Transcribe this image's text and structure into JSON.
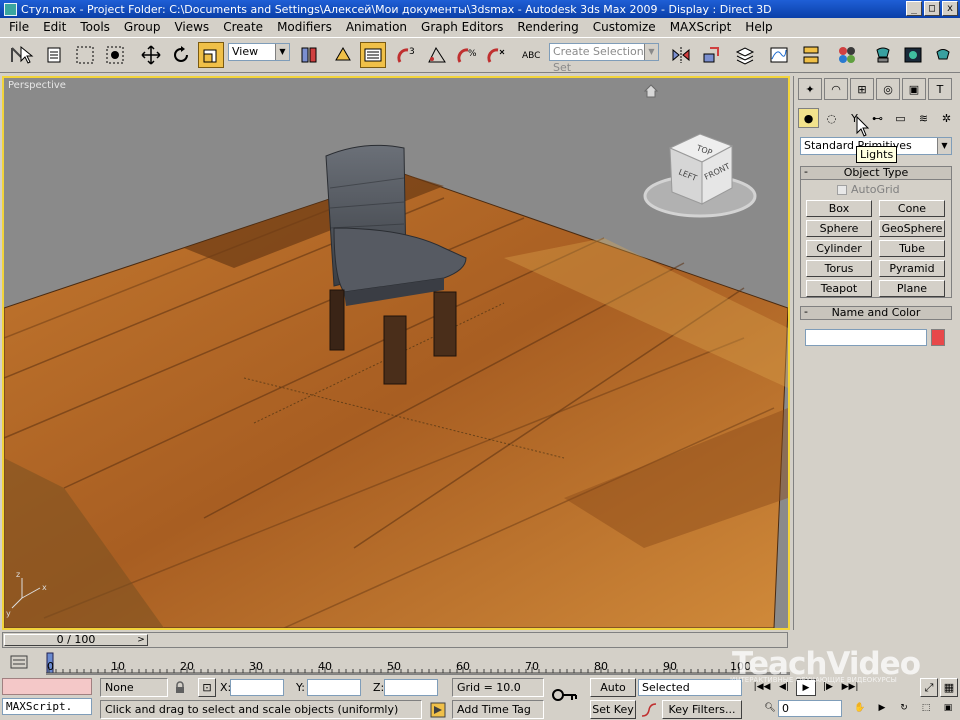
{
  "window": {
    "title": "Стул.max    - Project Folder: C:\\Documents and Settings\\Алексей\\Мои документы\\3dsmax    - Autodesk 3ds Max  2009    - Display : Direct 3D",
    "minimize": "_",
    "maximize": "□",
    "close": "x"
  },
  "menu": [
    "File",
    "Edit",
    "Tools",
    "Group",
    "Views",
    "Create",
    "Modifiers",
    "Animation",
    "Graph Editors",
    "Rendering",
    "Customize",
    "MAXScript",
    "Help"
  ],
  "toolbar": {
    "reference_coord": "View",
    "selection_set": "Create Selection Set"
  },
  "viewport": {
    "label": "Perspective",
    "viewcube": {
      "top": "TOP",
      "left": "LEFT",
      "front": "FRONT"
    }
  },
  "command_panel": {
    "category": "Standard Primitives",
    "tooltip": "Lights",
    "object_type": {
      "title": "Object Type",
      "autogrid": "AutoGrid",
      "buttons": [
        "Box",
        "Cone",
        "Sphere",
        "GeoSphere",
        "Cylinder",
        "Tube",
        "Torus",
        "Pyramid",
        "Teapot",
        "Plane"
      ]
    },
    "name_and_color": {
      "title": "Name and Color",
      "name_value": "",
      "color": "#e8484a"
    }
  },
  "time": {
    "frame": "0 / 100",
    "ticks": [
      "0",
      "10",
      "20",
      "30",
      "40",
      "50",
      "60",
      "70",
      "80",
      "90",
      "100"
    ]
  },
  "status": {
    "maxscript": "MAXScript.",
    "selection": "None Selecte",
    "x_label": "X:",
    "y_label": "Y:",
    "z_label": "Z:",
    "grid": "Grid = 10.0",
    "prompt": "Click and drag to select and scale objects (uniformly)",
    "add_time_tag": "Add Time Tag",
    "auto_key": "Auto Key",
    "set_key": "Set Key",
    "key_mode": "Selected",
    "key_filters": "Key Filters...",
    "current_frame": "0"
  },
  "watermark": {
    "brand": "TeachVideo",
    "tagline": "ИНТЕРАКТИВНЫЕ ОБУЧАЮЩИЕ ВИДЕОКУРСЫ"
  }
}
